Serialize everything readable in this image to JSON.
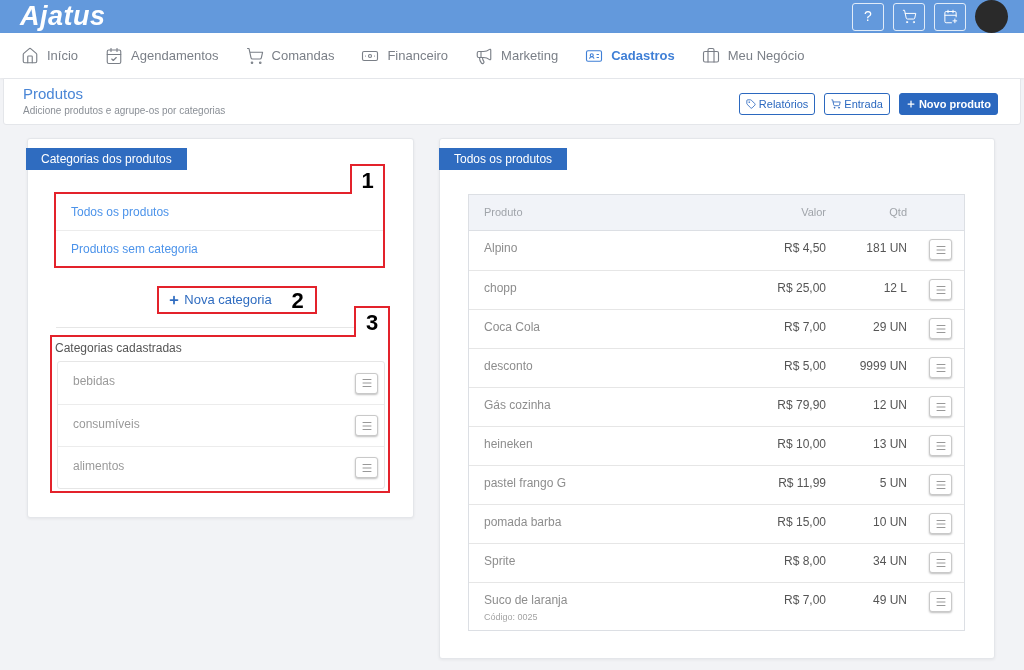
{
  "header": {
    "logo": "Ajatus",
    "help": "?"
  },
  "nav": [
    {
      "label": "Início",
      "selected": false
    },
    {
      "label": "Agendamentos",
      "selected": false
    },
    {
      "label": "Comandas",
      "selected": false
    },
    {
      "label": "Financeiro",
      "selected": false
    },
    {
      "label": "Marketing",
      "selected": false
    },
    {
      "label": "Cadastros",
      "selected": true
    },
    {
      "label": "Meu Negócio",
      "selected": false
    }
  ],
  "page": {
    "title": "Produtos",
    "subtitle": "Adicione produtos e agrupe-os por categorias",
    "actions": [
      {
        "label": "Relatórios",
        "kind": "outline"
      },
      {
        "label": "Entrada",
        "kind": "outline"
      },
      {
        "label": "Novo produto",
        "kind": "primary"
      }
    ]
  },
  "categories_panel": {
    "title": "Categorias dos produtos",
    "filters": [
      "Todos os produtos",
      "Produtos sem categoria"
    ],
    "new_button": "Nova categoria",
    "registered_title": "Categorias cadastradas",
    "categories": [
      "bebidas",
      "consumíveis",
      "alimentos"
    ],
    "annotations": [
      "1",
      "2",
      "3"
    ]
  },
  "products_panel": {
    "title": "Todos os produtos",
    "columns": [
      "Produto",
      "Valor",
      "Qtd"
    ],
    "rows": [
      {
        "name": "Alpino",
        "price": "R$ 4,50",
        "qty": "181 UN"
      },
      {
        "name": "chopp",
        "price": "R$ 25,00",
        "qty": "12 L"
      },
      {
        "name": "Coca Cola",
        "price": "R$ 7,00",
        "qty": "29 UN"
      },
      {
        "name": "desconto",
        "price": "R$ 5,00",
        "qty": "9999 UN"
      },
      {
        "name": "Gás cozinha",
        "price": "R$ 79,90",
        "qty": "12 UN"
      },
      {
        "name": "heineken",
        "price": "R$ 10,00",
        "qty": "13 UN"
      },
      {
        "name": "pastel frango G",
        "price": "R$ 11,99",
        "qty": "5 UN"
      },
      {
        "name": "pomada barba",
        "price": "R$ 15,00",
        "qty": "10 UN"
      },
      {
        "name": "Sprite",
        "price": "R$ 8,00",
        "qty": "34 UN"
      },
      {
        "name": "Suco de laranja",
        "code": "Código: 0025",
        "price": "R$ 7,00",
        "qty": "49 UN"
      }
    ]
  }
}
